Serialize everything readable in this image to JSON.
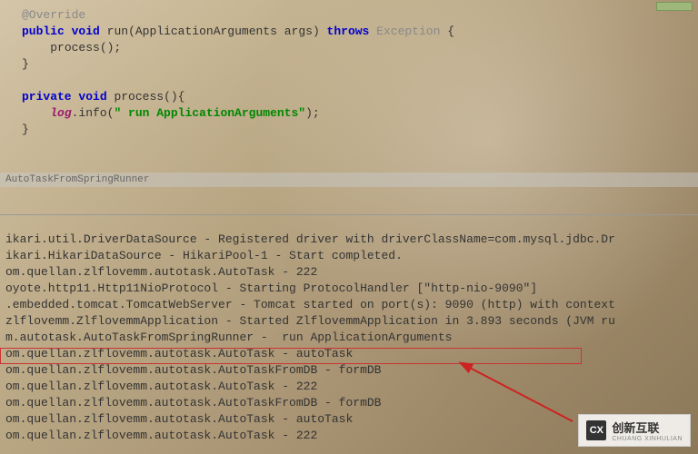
{
  "editor": {
    "annotation": "@Override",
    "kw_public": "public",
    "kw_void1": "void",
    "method_run": "run",
    "param_type": "ApplicationArguments",
    "param_name": "args",
    "kw_throws": "throws",
    "exception": "Exception",
    "call_process": "process();",
    "kw_private": "private",
    "kw_void2": "void",
    "method_process": "process",
    "field_log": "log",
    "call_info": ".info(",
    "string_msg": "\" run ApplicationArguments\"",
    "close_paren": ");",
    "gutter_label": "AutoTaskFromSpringRunner"
  },
  "console": {
    "lines": [
      "ikari.util.DriverDataSource - Registered driver with driverClassName=com.mysql.jdbc.Dr",
      "ikari.HikariDataSource - HikariPool-1 - Start completed.",
      "om.quellan.zlflovemm.autotask.AutoTask - 222",
      "oyote.http11.Http11NioProtocol - Starting ProtocolHandler [\"http-nio-9090\"]",
      ".embedded.tomcat.TomcatWebServer - Tomcat started on port(s): 9090 (http) with context",
      "zlflovemm.ZlflovemmApplication - Started ZlflovemmApplication in 3.893 seconds (JVM ru",
      "m.autotask.AutoTaskFromSpringRunner -  run ApplicationArguments",
      "om.quellan.zlflovemm.autotask.AutoTask - autoTask",
      "om.quellan.zlflovemm.autotask.AutoTaskFromDB - formDB",
      "om.quellan.zlflovemm.autotask.AutoTask - 222",
      "om.quellan.zlflovemm.autotask.AutoTaskFromDB - formDB",
      "om.quellan.zlflovemm.autotask.AutoTask - autoTask",
      "om.quellan.zlflovemm.autotask.AutoTask - 222"
    ]
  },
  "watermark": {
    "logo": "CX",
    "main": "创新互联",
    "sub": "CHUANG XINHULIAN"
  }
}
